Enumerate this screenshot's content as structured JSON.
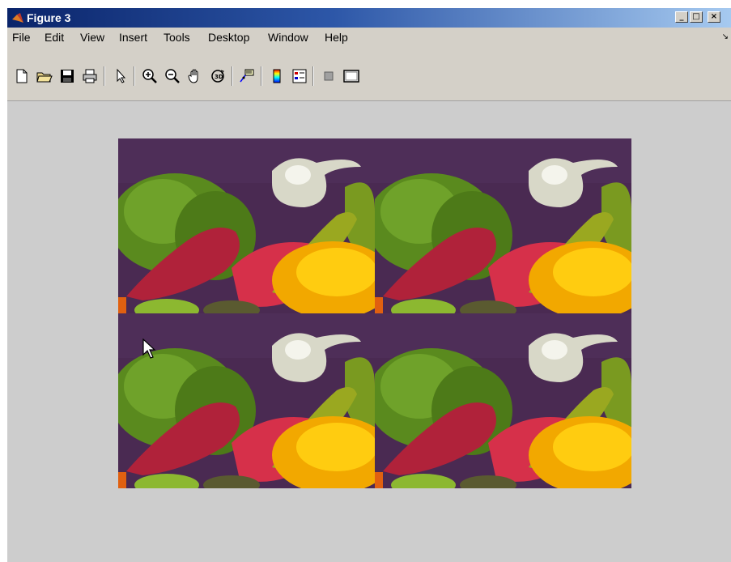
{
  "window": {
    "title": "Figure 3"
  },
  "title_buttons": [
    "minimize-button",
    "maximize-button",
    "close-button"
  ],
  "menu": {
    "items": [
      "File",
      "Edit",
      "View",
      "Insert",
      "Tools",
      "Desktop",
      "Window",
      "Help"
    ],
    "overflow_icon": "chevron-arrow-icon"
  },
  "toolbar": {
    "tools": [
      "new-figure-icon",
      "open-file-icon",
      "save-icon",
      "print-icon",
      "edit-plot-icon",
      "zoom-in-icon",
      "zoom-out-icon",
      "pan-hand-icon",
      "rotate-3d-icon",
      "data-cursor-icon",
      "colorbar-icon",
      "legend-icon",
      "hide-plot-tools-icon",
      "show-plot-tools-icon"
    ]
  },
  "figure": {
    "tiles": 4,
    "background": "#cdcdcd"
  }
}
